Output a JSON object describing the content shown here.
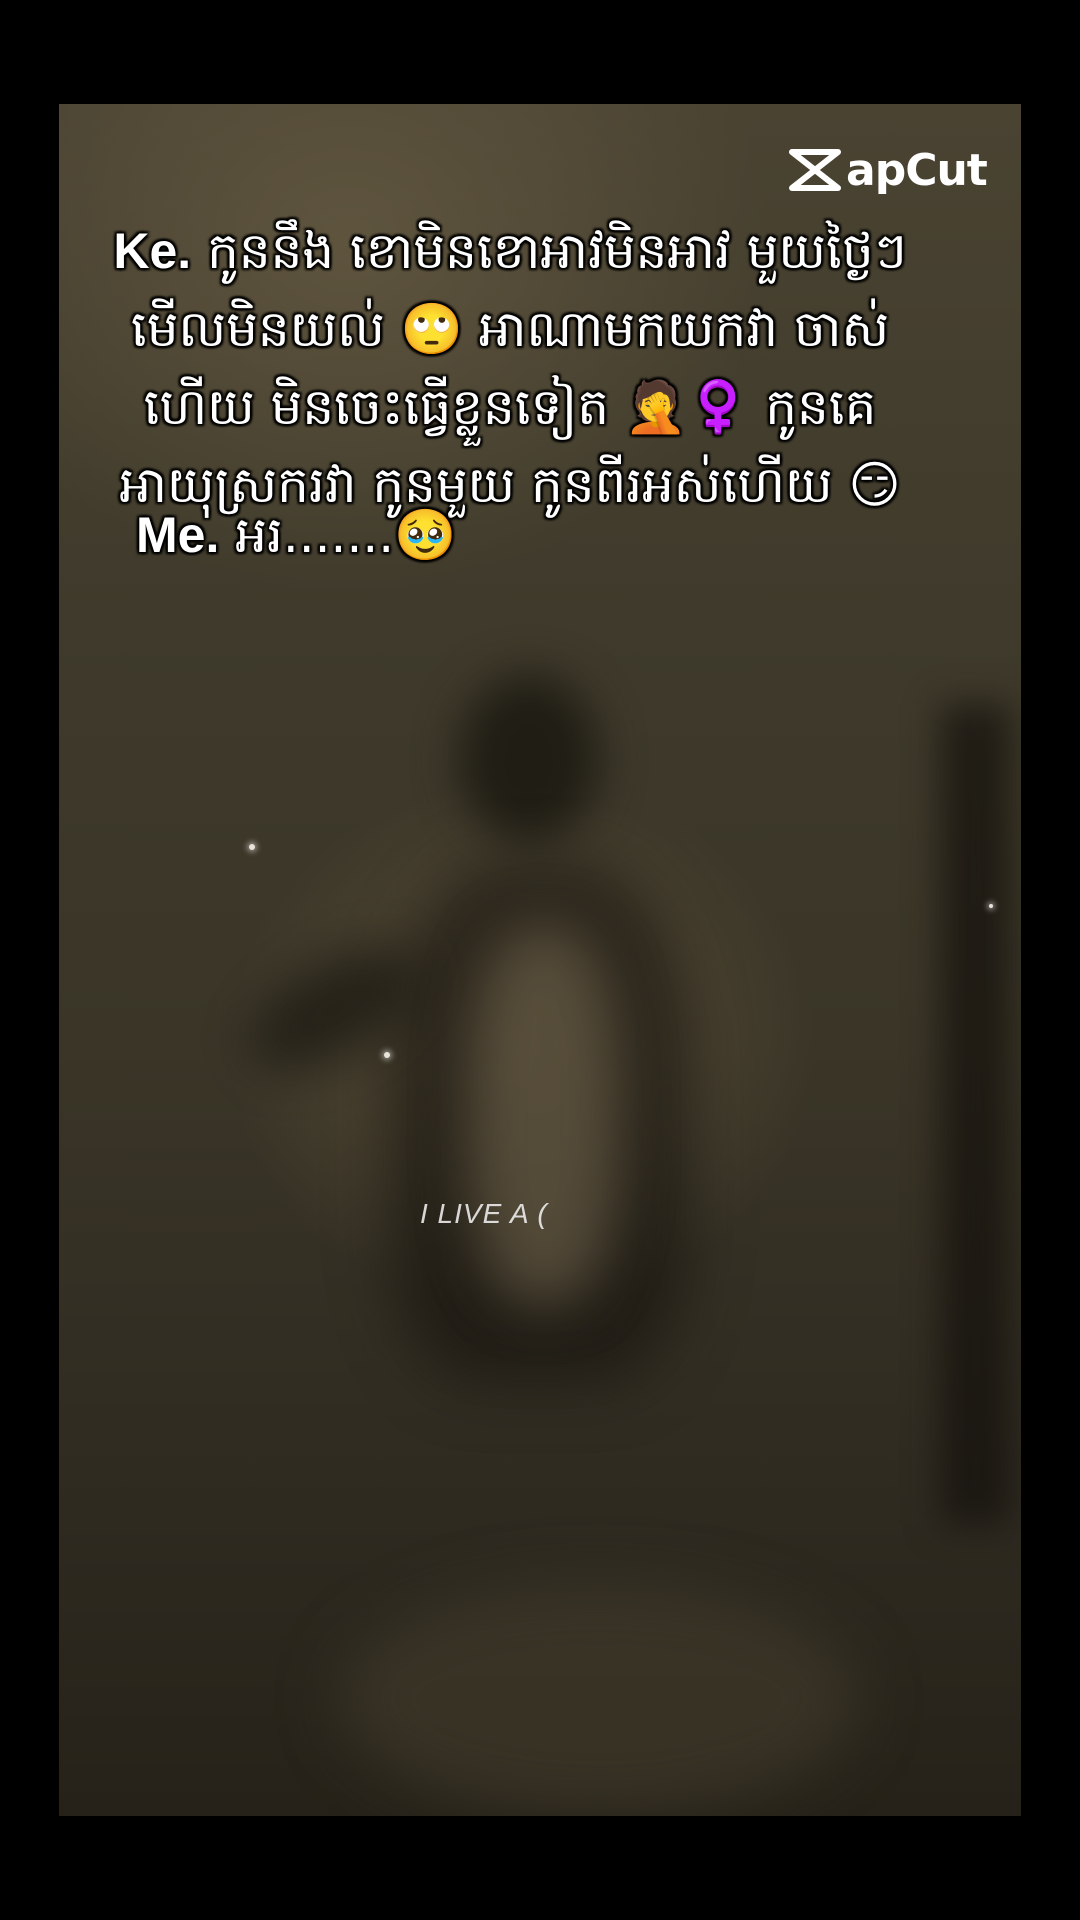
{
  "logo": {
    "text": "apCut",
    "icon": "capcut-logo-icon"
  },
  "caption": {
    "speaker": "Ke.",
    "message": "កូននឹង ខោមិនខោអាវមិនអាវ មួយថ្ងៃៗ មើលមិនយល់ 🙄 អាណាមកយកវា ចាស់ហើយ មិនចេះធ្វើខ្លួនទៀត 🤦‍♀️ កូនគេ អាយុស្រករវា កូនមួយ កូនពីរអស់ហើយ 😏"
  },
  "reply": {
    "speaker": "Me.",
    "message": "អរ.......🥹"
  },
  "overlay_text": "I LIVE A (",
  "colors": {
    "frame": "#000000",
    "text": "#ffffff",
    "scene_tone": "#3f3a2b"
  }
}
